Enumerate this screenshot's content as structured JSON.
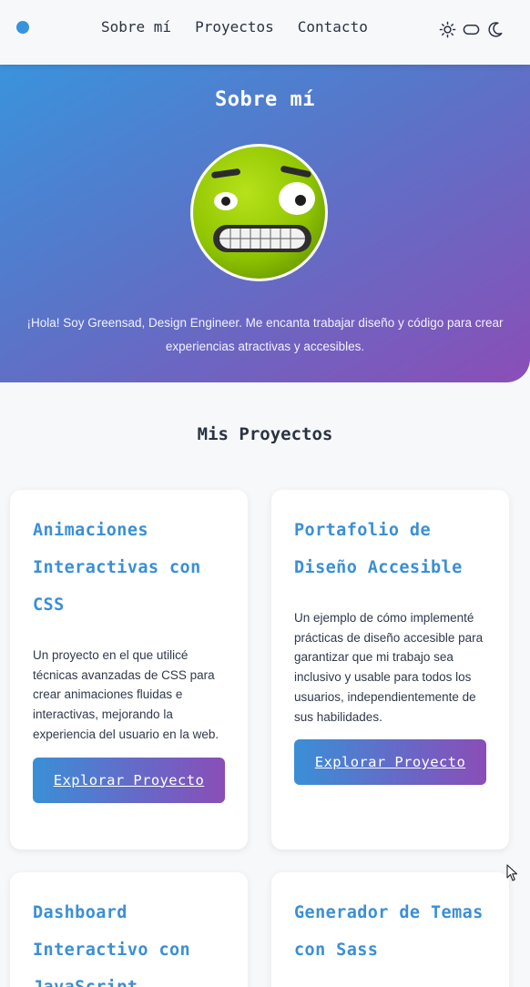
{
  "nav": {
    "links": [
      "Sobre mí",
      "Proyectos",
      "Contacto"
    ]
  },
  "theme": {
    "icons": [
      "sun-icon",
      "toggle-icon",
      "moon-icon"
    ]
  },
  "colors": {
    "accent": "#3793dd",
    "gradient_start": "#3a93dc",
    "gradient_end": "#8a4eb7"
  },
  "hero": {
    "title": "Sobre mí",
    "bio": "¡Hola! Soy Greensad, Design Engineer. Me encanta trabajar diseño y código para crear experiencias atractivas y accesibles."
  },
  "projects": {
    "title": "Mis Proyectos",
    "cards": [
      {
        "title": "Animaciones Interactivas con CSS",
        "description": "Un proyecto en el que utilicé técnicas avanzadas de CSS para crear animaciones fluidas e interactivas, mejorando la experiencia del usuario en la web.",
        "button": "Explorar Proyecto"
      },
      {
        "title": "Portafolio de Diseño Accesible",
        "description": "Un ejemplo de cómo implementé prácticas de diseño accesible para garantizar que mi trabajo sea inclusivo y usable para todos los usuarios, independientemente de sus habilidades.",
        "button": "Explorar Proyecto"
      },
      {
        "title": "Dashboard Interactivo con JavaScript"
      },
      {
        "title": "Generador de Temas con Sass"
      }
    ]
  }
}
